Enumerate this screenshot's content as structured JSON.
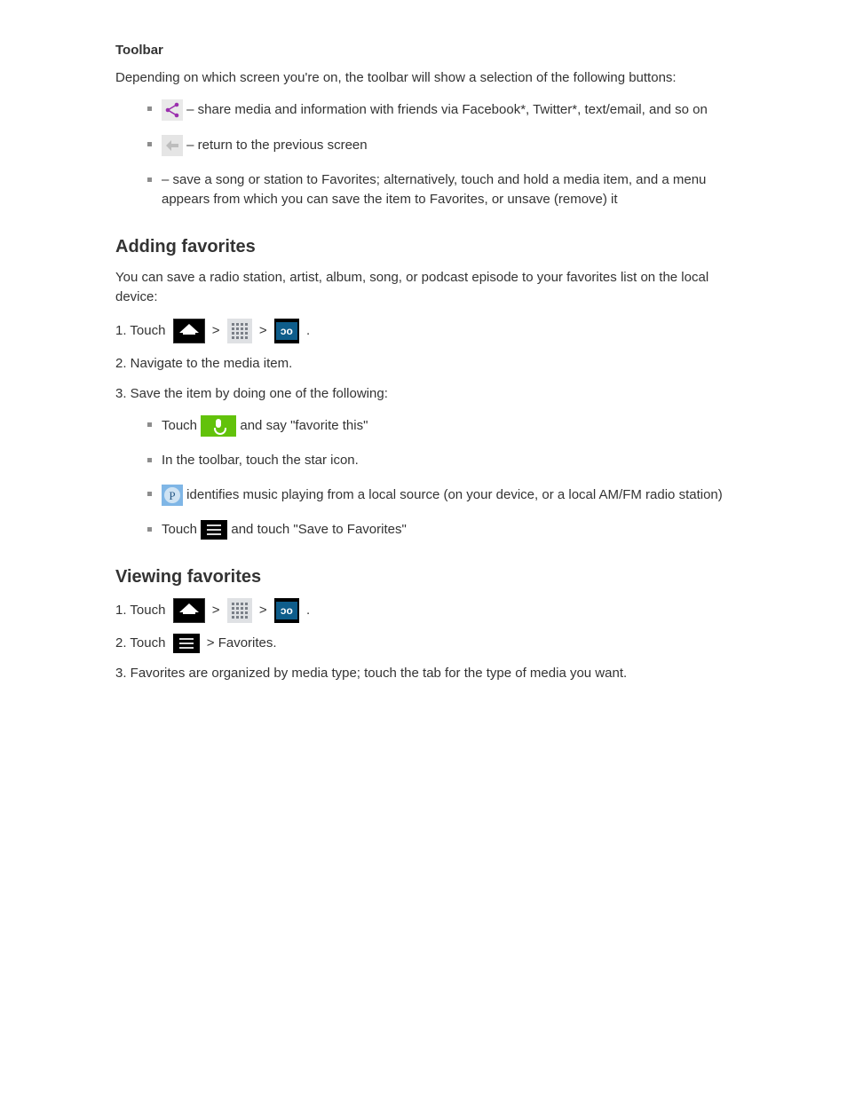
{
  "toolbar": {
    "heading": "Toolbar",
    "intro": "Depending on which screen you're on, the toolbar will show a selection of the following buttons:",
    "items": [
      {
        "icon": "share-icon",
        "text": " – share media and information with friends via Facebook*, Twitter*, text/email, and so on"
      },
      {
        "icon": "back-icon",
        "text": " – return to the previous screen"
      },
      {
        "icon": "star-icon",
        "text": " – save a song or station to Favorites; alternatively, touch and hold a media item, and a menu appears from which you can save the item to Favorites, or unsave (remove) it"
      }
    ]
  },
  "favorites": {
    "heading": "Adding favorites",
    "intro": "You can save a radio station, artist, album, song, or podcast episode to your favorites list on the local device:",
    "step1_a": "1.  Touch ",
    "step1_b": " > ",
    "step1_c": " > ",
    "step1_d": ".",
    "step2": "2.  Navigate to the media item.",
    "step3": "3.  Save the item by doing one of the following:",
    "methods": [
      {
        "pre": "Touch ",
        "icon": "mic-icon",
        "post": " and say \"favorite this\""
      },
      {
        "pre": "",
        "icon": null,
        "post": "In the toolbar, touch the star icon."
      },
      {
        "pre": "",
        "icon": "ident-icon",
        "post": " identifies music playing from a local source (on your device, or a local AM/FM radio station)"
      },
      {
        "pre": "Touch ",
        "icon": "list-icon",
        "post": " and touch \"Save to Favorites\""
      }
    ]
  },
  "viewing": {
    "heading": "Viewing favorites",
    "step1_a": "1.  Touch ",
    "step1_b": " > ",
    "step1_c": " > ",
    "step1_d": ".",
    "step2_a": "2.  Touch ",
    "step2_b": " > Favorites.",
    "step3": "3.  Favorites are organized by media type; touch the tab for the type of media you want."
  }
}
